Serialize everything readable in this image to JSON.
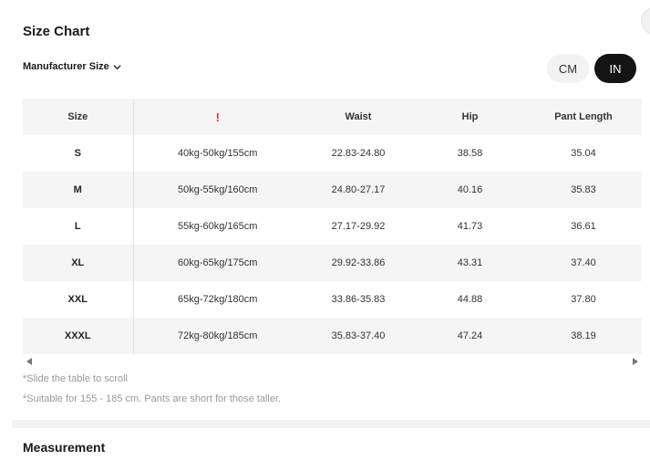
{
  "header": {
    "title": "Size Chart",
    "manufacturer_label": "Manufacturer Size"
  },
  "units": {
    "cm_label": "CM",
    "in_label": "IN",
    "selected": "IN"
  },
  "table": {
    "columns": [
      "Size",
      "!",
      "Waist",
      "Hip",
      "Pant Length"
    ],
    "rows": [
      {
        "size": "S",
        "info": "40kg-50kg/155cm",
        "waist": "22.83-24.80",
        "hip": "38.58",
        "pant_length": "35.04"
      },
      {
        "size": "M",
        "info": "50kg-55kg/160cm",
        "waist": "24.80-27.17",
        "hip": "40.16",
        "pant_length": "35.83"
      },
      {
        "size": "L",
        "info": "55kg-60kg/165cm",
        "waist": "27.17-29.92",
        "hip": "41.73",
        "pant_length": "36.61"
      },
      {
        "size": "XL",
        "info": "60kg-65kg/175cm",
        "waist": "29.92-33.86",
        "hip": "43.31",
        "pant_length": "37.40"
      },
      {
        "size": "XXL",
        "info": "65kg-72kg/180cm",
        "waist": "33.86-35.83",
        "hip": "44.88",
        "pant_length": "37.80"
      },
      {
        "size": "XXXL",
        "info": "72kg-80kg/185cm",
        "waist": "35.83-37.40",
        "hip": "47.24",
        "pant_length": "38.19"
      }
    ]
  },
  "notes": {
    "scroll": "*Slide the table to scroll",
    "suitable": "*Suitable for 155 - 185 cm. Pants are short for those taller."
  },
  "sections": {
    "measurement": "Measurement"
  },
  "colors": {
    "accent_dark": "#141414",
    "warning": "#e0323a",
    "row_shade": "#f5f5f5"
  }
}
